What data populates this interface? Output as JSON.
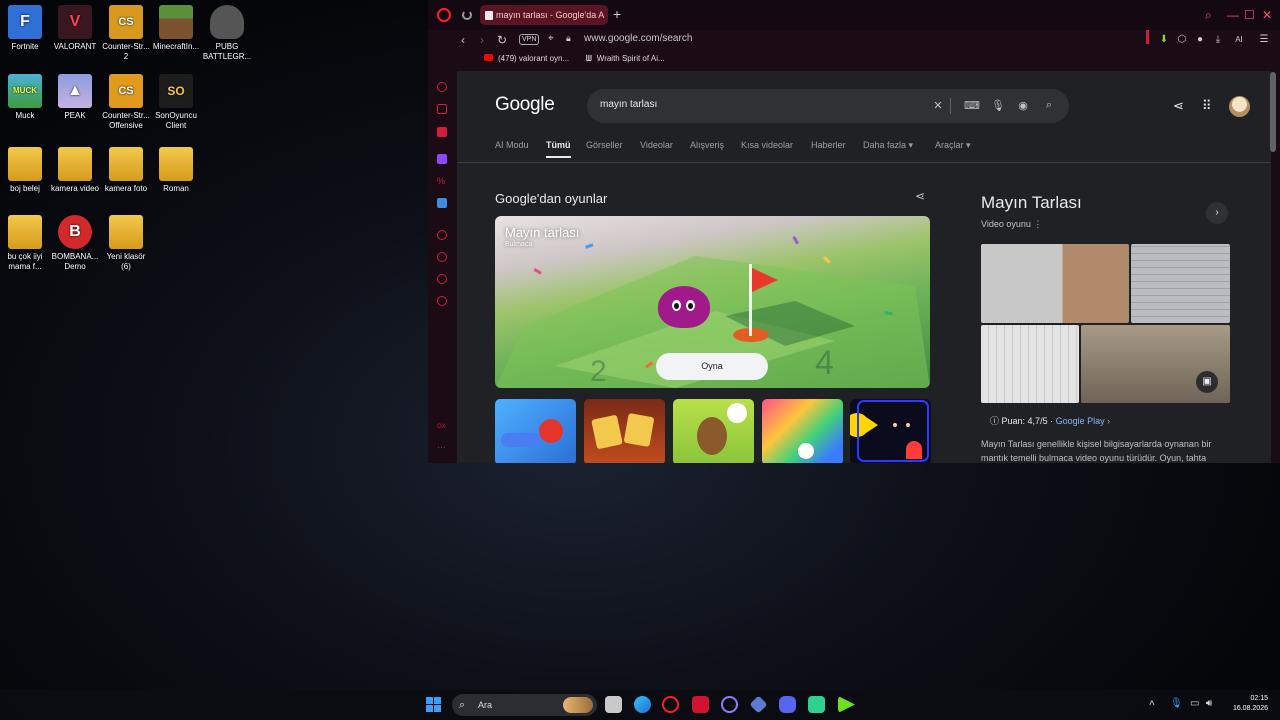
{
  "desktop": {
    "icons": [
      {
        "label": "Fortnite",
        "color": "#2f6fd6",
        "glyph": "F"
      },
      {
        "label": "VALORANT",
        "color": "#fd4556",
        "glyph": "V"
      },
      {
        "label": "Counter-Str... 2",
        "color": "#d79a1e",
        "glyph": "CS"
      },
      {
        "label": "MinecraftIn...",
        "color": "#5b8f3a",
        "glyph": "M"
      },
      {
        "label": "PUBG BATTLEGR...",
        "color": "#6b6b6b",
        "glyph": "P"
      },
      {
        "label": "Muck",
        "color": "#4bb2d8",
        "glyph": "MUCK"
      },
      {
        "label": "PEAK",
        "color": "#a8b6e6",
        "glyph": "▲"
      },
      {
        "label": "Counter-Str... Offensive",
        "color": "#e09a1d",
        "glyph": "CS"
      },
      {
        "label": "SonOyuncu Client",
        "color": "#1d1d1d",
        "glyph": "SO"
      },
      {
        "label": "boj belej",
        "color": "#e6b530",
        "glyph": ""
      },
      {
        "label": "kamera video",
        "color": "#e6b530",
        "glyph": ""
      },
      {
        "label": "kamera foto",
        "color": "#e6b530",
        "glyph": ""
      },
      {
        "label": "Roman",
        "color": "#e6b530",
        "glyph": ""
      },
      {
        "label": "bu çok iiyi mama f...",
        "color": "#e6b530",
        "glyph": ""
      },
      {
        "label": "BOMBANA... Demo",
        "color": "#d22a2a",
        "glyph": "B"
      },
      {
        "label": "Yeni klasör (6)",
        "color": "#e6b530",
        "glyph": ""
      }
    ]
  },
  "browser": {
    "tab_title": "mayın tarlası - Google'da A",
    "url": "www.google.com/search",
    "vpn_label": "VPN",
    "ai_label": "AI",
    "bookmarks": [
      "(479) valorant oyn...",
      "Wraith Spirit of Ai..."
    ]
  },
  "google": {
    "logo": "Google",
    "query": "mayın tarlası",
    "tabs": [
      "AI Modu",
      "Tümü",
      "Görseller",
      "Videolar",
      "Alışveriş",
      "Kısa videolar",
      "Haberler",
      "Daha fazla",
      "Araçlar"
    ],
    "active_tab": "Tümü",
    "games_heading": "Google'dan oyunlar",
    "hero_title": "Mayın tarlası",
    "hero_subtitle": "Bulmaca",
    "play_button": "Oyna",
    "knowledge": {
      "title": "Mayın Tarlası",
      "subtitle": "Video oyunu",
      "rating_prefix": "Puan: 4,7/5 · ",
      "rating_source": "Google Play",
      "description": "Mayın Tarlası genellikle kişisel bilgisayarlarda oynanan bir mantık temelli bulmaca video oyunu türüdür. Oyun, tahta"
    }
  },
  "taskbar": {
    "search_placeholder": "Ara",
    "time": "02:15",
    "date": "16.08.2026"
  }
}
